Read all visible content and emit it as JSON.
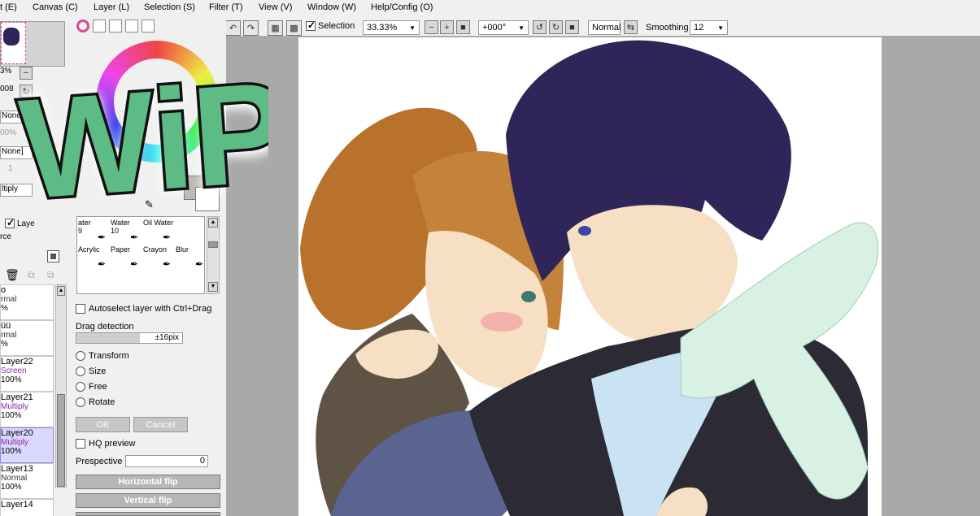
{
  "menubar": {
    "items": [
      "t (E)",
      "Canvas (C)",
      "Layer (L)",
      "Selection (S)",
      "Filter (T)",
      "View (V)",
      "Window (W)",
      "Help/Config (O)"
    ]
  },
  "toolbar": {
    "selection_label": "Selection",
    "zoom_value": "33.33%",
    "rotation_value": "+000°",
    "blend_value": "Normal",
    "smoothing_label": "Smoothing",
    "smoothing_value": "12"
  },
  "navigator": {
    "zoom_partial": "3%",
    "angle_partial": "008"
  },
  "left_partial": {
    "none1": "None]",
    "pct": "00%",
    "none2": "None]",
    "one": "1",
    "mode": "ltiply",
    "layer_check_label": "Laye",
    "source_label": "rce"
  },
  "layers": [
    {
      "name": "o",
      "mode": "rmal",
      "opacity": "%",
      "selected": false,
      "purple": false
    },
    {
      "name": "üü",
      "mode": "rmal",
      "opacity": "%",
      "selected": false,
      "purple": false
    },
    {
      "name": "Layer22",
      "mode": "Screen",
      "opacity": "100%",
      "selected": false,
      "purple": true
    },
    {
      "name": "Layer21",
      "mode": "Multiply",
      "opacity": "100%",
      "selected": false,
      "purple": true
    },
    {
      "name": "Layer20",
      "mode": "Multiply",
      "opacity": "100%",
      "selected": true,
      "purple": true
    },
    {
      "name": "Layer13",
      "mode": "Normal",
      "opacity": "100%",
      "selected": false,
      "purple": false
    },
    {
      "name": "Layer14",
      "mode": "",
      "opacity": "",
      "selected": false,
      "purple": false
    }
  ],
  "brushes": [
    {
      "name": "ater",
      "size": "9"
    },
    {
      "name": "Water",
      "size": "10"
    },
    {
      "name": "Oil Water",
      "size": ""
    },
    {
      "name": "",
      "size": ""
    },
    {
      "name": "Acrylic",
      "size": ""
    },
    {
      "name": "Paper",
      "size": ""
    },
    {
      "name": "Crayon",
      "size": ""
    },
    {
      "name": "Blur",
      "size": ""
    }
  ],
  "transform": {
    "autoselect_label": "Autoselect layer with Ctrl+Drag",
    "drag_detection_label": "Drag detection",
    "drag_value": "±16pix",
    "options": [
      "Transform",
      "Size",
      "Free",
      "Rotate"
    ],
    "ok_label": "OK",
    "cancel_label": "Cancel",
    "hq_preview_label": "HQ preview",
    "perspective_label": "Prespective",
    "perspective_value": "0",
    "hflip_label": "Horizontal flip",
    "vflip_label": "Vertical flip"
  },
  "overlay": {
    "wip_text": "WiP!"
  },
  "colors": {
    "hair_girl": "#b8722c",
    "hair_boy": "#2f2558",
    "scarf": "#d9f1e4",
    "jacket_boy": "#2b2a35",
    "hoodie_girl": "#5b6491",
    "skin": "#f6dfc3",
    "wip_green": "#5dbb85"
  }
}
